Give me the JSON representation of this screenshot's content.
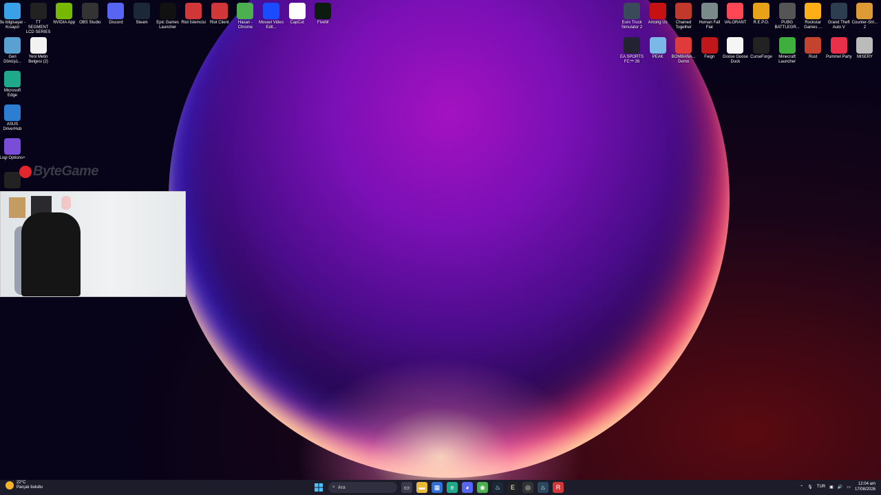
{
  "desktop": {
    "left_icons_row1": [
      {
        "label": "Bu bilgisayar - Kısayol",
        "icon": "computer-icon",
        "color": "#3aa0e8"
      },
      {
        "label": "TT SEGMENT LCD SERIES",
        "icon": "tt-icon",
        "color": "#222"
      },
      {
        "label": "NVIDIA App",
        "icon": "nvidia-icon",
        "color": "#76b900"
      },
      {
        "label": "OBS Studio",
        "icon": "obs-icon",
        "color": "#333"
      },
      {
        "label": "Discord",
        "icon": "discord-icon",
        "color": "#5865f2"
      },
      {
        "label": "Steam",
        "icon": "steam-icon",
        "color": "#1b2838"
      },
      {
        "label": "Epic Games Launcher",
        "icon": "epic-icon",
        "color": "#111"
      },
      {
        "label": "Riot İstemcisi",
        "icon": "riot-icon",
        "color": "#d13639"
      },
      {
        "label": "Riot Client",
        "icon": "riot-icon",
        "color": "#d13639"
      },
      {
        "label": "Hasan - Chrome",
        "icon": "chrome-icon",
        "color": "#4caf50"
      },
      {
        "label": "Movavi Video Edit...",
        "icon": "movavi-icon",
        "color": "#1a4cff"
      },
      {
        "label": "CapCut",
        "icon": "capcut-icon",
        "color": "#fff"
      },
      {
        "label": "FiveM",
        "icon": "fivem-icon",
        "color": "#0d1a10"
      }
    ],
    "left_icons_col": [
      {
        "label": "Geri Dönüşü...",
        "icon": "recycle-bin-icon",
        "color": "#5aa0d0"
      },
      {
        "label": "Yeni Metin Belgesi (2)",
        "icon": "text-document-icon",
        "color": "#f2f2f2"
      },
      {
        "label": "Microsoft Edge",
        "icon": "edge-icon",
        "color": "#1fa88a"
      },
      {
        "label": "ASUS DriverHub",
        "icon": "asus-icon",
        "color": "#2d7dd2"
      },
      {
        "label": "Logi Options+",
        "icon": "logi-icon",
        "color": "#7a4dd8"
      },
      {
        "label": "",
        "icon": "ubisoft-icon",
        "color": "#222"
      }
    ],
    "right_icons_row1": [
      {
        "label": "Euro Truck Simulator 2",
        "icon": "ets2-icon",
        "color": "#3a4a5a"
      },
      {
        "label": "Among Us",
        "icon": "among-us-icon",
        "color": "#c51111"
      },
      {
        "label": "Chained Together",
        "icon": "chained-together-icon",
        "color": "#c0392b"
      },
      {
        "label": "Human Fall Flat",
        "icon": "human-fall-flat-icon",
        "color": "#7a8a8a"
      },
      {
        "label": "VALORANT",
        "icon": "valorant-icon",
        "color": "#ff4655"
      },
      {
        "label": "R.E.P.O.",
        "icon": "repo-icon",
        "color": "#e8a21a"
      },
      {
        "label": "PUBG BATTLEGR...",
        "icon": "pubg-icon",
        "color": "#555"
      },
      {
        "label": "Rockstar Games ...",
        "icon": "rockstar-icon",
        "color": "#fcaf17"
      },
      {
        "label": "Grand Theft Auto V",
        "icon": "gta-icon",
        "color": "#2c3e50"
      },
      {
        "label": "Counter-Stri... 2",
        "icon": "cs2-icon",
        "color": "#de9b35"
      }
    ],
    "right_icons_row2": [
      {
        "label": "EA SPORTS FC™ 26",
        "icon": "ea-fc-icon",
        "color": "#223"
      },
      {
        "label": "PEAK",
        "icon": "peak-icon",
        "color": "#7ab8e8"
      },
      {
        "label": "BOMBANA... Demo",
        "icon": "bombana-icon",
        "color": "#e03a3a"
      },
      {
        "label": "Feign",
        "icon": "feign-icon",
        "color": "#c0181a"
      },
      {
        "label": "Goose Goose Duck",
        "icon": "goose-goose-duck-icon",
        "color": "#f5f5f5"
      },
      {
        "label": "CurseForge",
        "icon": "curseforge-icon",
        "color": "#222"
      },
      {
        "label": "Minecraft Launcher",
        "icon": "minecraft-icon",
        "color": "#3fae3f"
      },
      {
        "label": "Rust",
        "icon": "rust-icon",
        "color": "#c3432e"
      },
      {
        "label": "Pummel Party",
        "icon": "pummel-party-icon",
        "color": "#e8304a"
      },
      {
        "label": "MISERY",
        "icon": "misery-icon",
        "color": "#bbb"
      }
    ],
    "watermark": "ByteGame"
  },
  "taskbar": {
    "weather_temp": "22°C",
    "weather_desc": "Parçalı bulutlu",
    "search_placeholder": "Ara",
    "lang": "TUR",
    "time": "12:04 am",
    "date": "17/08/2026"
  }
}
